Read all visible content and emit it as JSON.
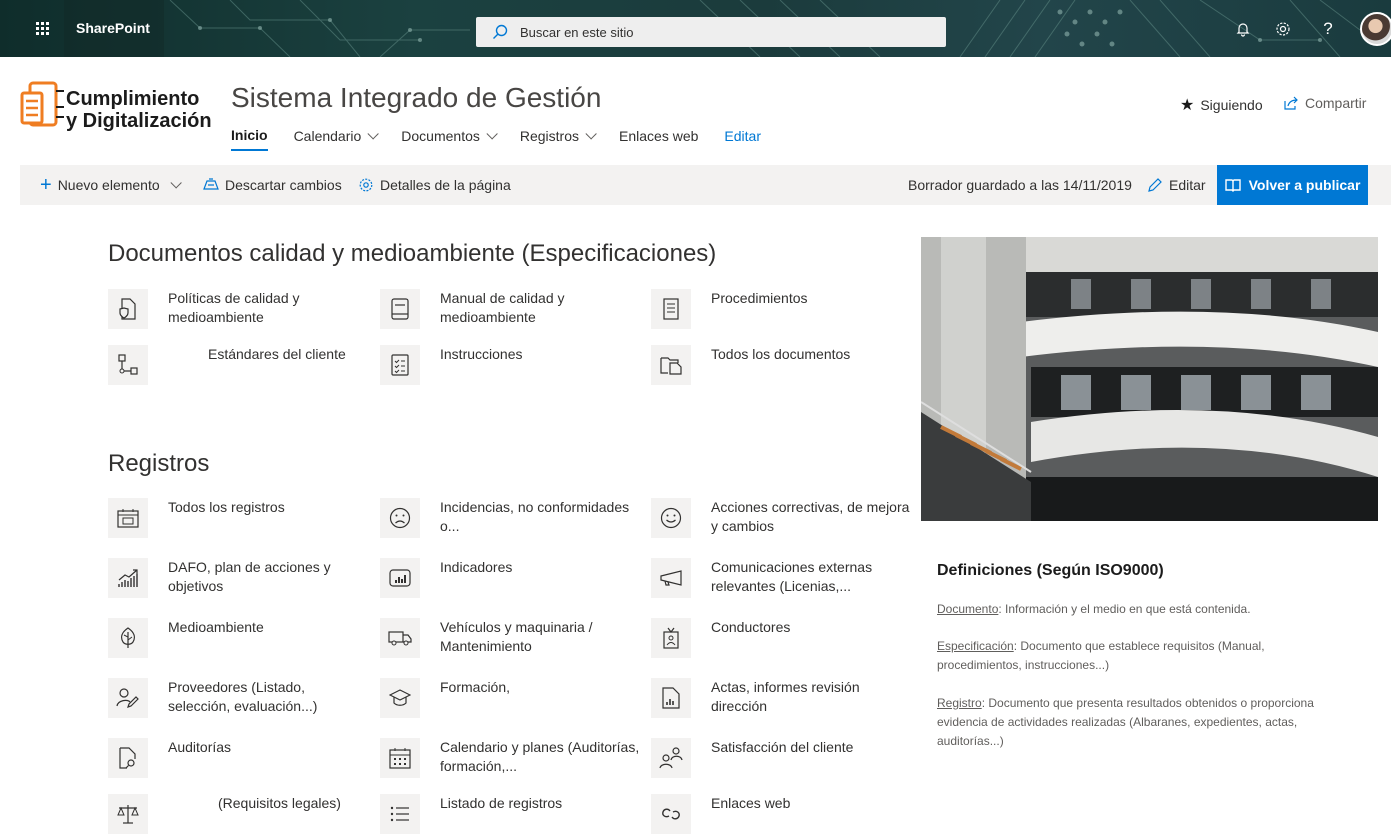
{
  "suite": {
    "brand": "SharePoint",
    "search_placeholder": "Buscar en este sitio",
    "icons": [
      "waffle-icon",
      "search-icon",
      "bell-icon",
      "gear-icon",
      "help-icon"
    ],
    "accent": "#0078d4"
  },
  "site": {
    "logo_line1": "Cumplimiento",
    "logo_line2": "y Digitalización",
    "title": "Sistema Integrado de Gestión",
    "nav": [
      {
        "label": "Inicio",
        "active": true,
        "dropdown": false
      },
      {
        "label": "Calendario",
        "active": false,
        "dropdown": true
      },
      {
        "label": "Documentos",
        "active": false,
        "dropdown": true
      },
      {
        "label": "Registros",
        "active": false,
        "dropdown": true
      },
      {
        "label": "Enlaces web",
        "active": false,
        "dropdown": false
      },
      {
        "label": "Editar",
        "active": false,
        "dropdown": false
      }
    ],
    "follow_label": "Siguiendo",
    "share_label": "Compartir"
  },
  "commandbar": {
    "new_item": "Nuevo elemento",
    "discard": "Descartar cambios",
    "page_details": "Detalles de la página",
    "draft_status": "Borrador guardado a las 14/11/2019",
    "edit": "Editar",
    "republish": "Volver a publicar"
  },
  "documents": {
    "title": "Documentos calidad y medioambiente (Especificaciones)",
    "links": [
      {
        "label": "Políticas de calidad y medioambiente",
        "icon": "document-shield-icon"
      },
      {
        "label": "Manual de calidad y medioambiente",
        "icon": "manual-icon"
      },
      {
        "label": "Procedimientos",
        "icon": "procedure-icon"
      },
      {
        "label": "Estándares del cliente",
        "icon": "flowchart-icon"
      },
      {
        "label": "Instrucciones",
        "icon": "checklist-icon"
      },
      {
        "label": "Todos los documentos",
        "icon": "documents-icon"
      }
    ]
  },
  "registros": {
    "title": "Registros",
    "links": [
      {
        "label": "Todos los registros",
        "icon": "calendar-list-icon"
      },
      {
        "label": "Incidencias, no conformidades o...",
        "icon": "sad-face-icon"
      },
      {
        "label": "Acciones correctivas, de mejora y cambios",
        "icon": "happy-face-icon"
      },
      {
        "label": "DAFO, plan de acciones y objetivos",
        "icon": "trend-chart-icon"
      },
      {
        "label": "Indicadores",
        "icon": "bar-chart-icon"
      },
      {
        "label": "Comunicaciones externas relevantes (Licenias,...",
        "icon": "megaphone-icon"
      },
      {
        "label": "Medioambiente",
        "icon": "leaf-icon"
      },
      {
        "label": "Vehículos y maquinaria / Mantenimiento",
        "icon": "truck-icon"
      },
      {
        "label": "Conductores",
        "icon": "badge-icon"
      },
      {
        "label": "Proveedores (Listado, selección, evaluación...)",
        "icon": "people-edit-icon"
      },
      {
        "label": "Formación,",
        "icon": "graduation-cap-icon"
      },
      {
        "label": "Actas, informes revisión dirección",
        "icon": "report-icon"
      },
      {
        "label": "Auditorías",
        "icon": "document-search-icon"
      },
      {
        "label": "Calendario y planes (Auditorías, formación,...",
        "icon": "calendar-icon"
      },
      {
        "label": "Satisfacción del cliente",
        "icon": "people-icon"
      },
      {
        "label": "(Requisitos legales)",
        "icon": "scales-icon"
      },
      {
        "label": "Listado de registros",
        "icon": "bullet-list-icon"
      },
      {
        "label": "Enlaces web",
        "icon": "link-icon"
      }
    ]
  },
  "definitions": {
    "title": "Definiciones (Según ISO9000)",
    "items": [
      {
        "term": "Documento",
        "text": ": Información y el medio en que está contenida."
      },
      {
        "term": "Especificación",
        "text": ": Documento que establece requisitos (Manual, procedimientos, instrucciones...)"
      },
      {
        "term": "Registro",
        "text": ": Documento que presenta resultados obtenidos o proporciona evidencia de actividades realizadas (Albaranes, expedientes, actas, auditorías...)"
      }
    ]
  }
}
